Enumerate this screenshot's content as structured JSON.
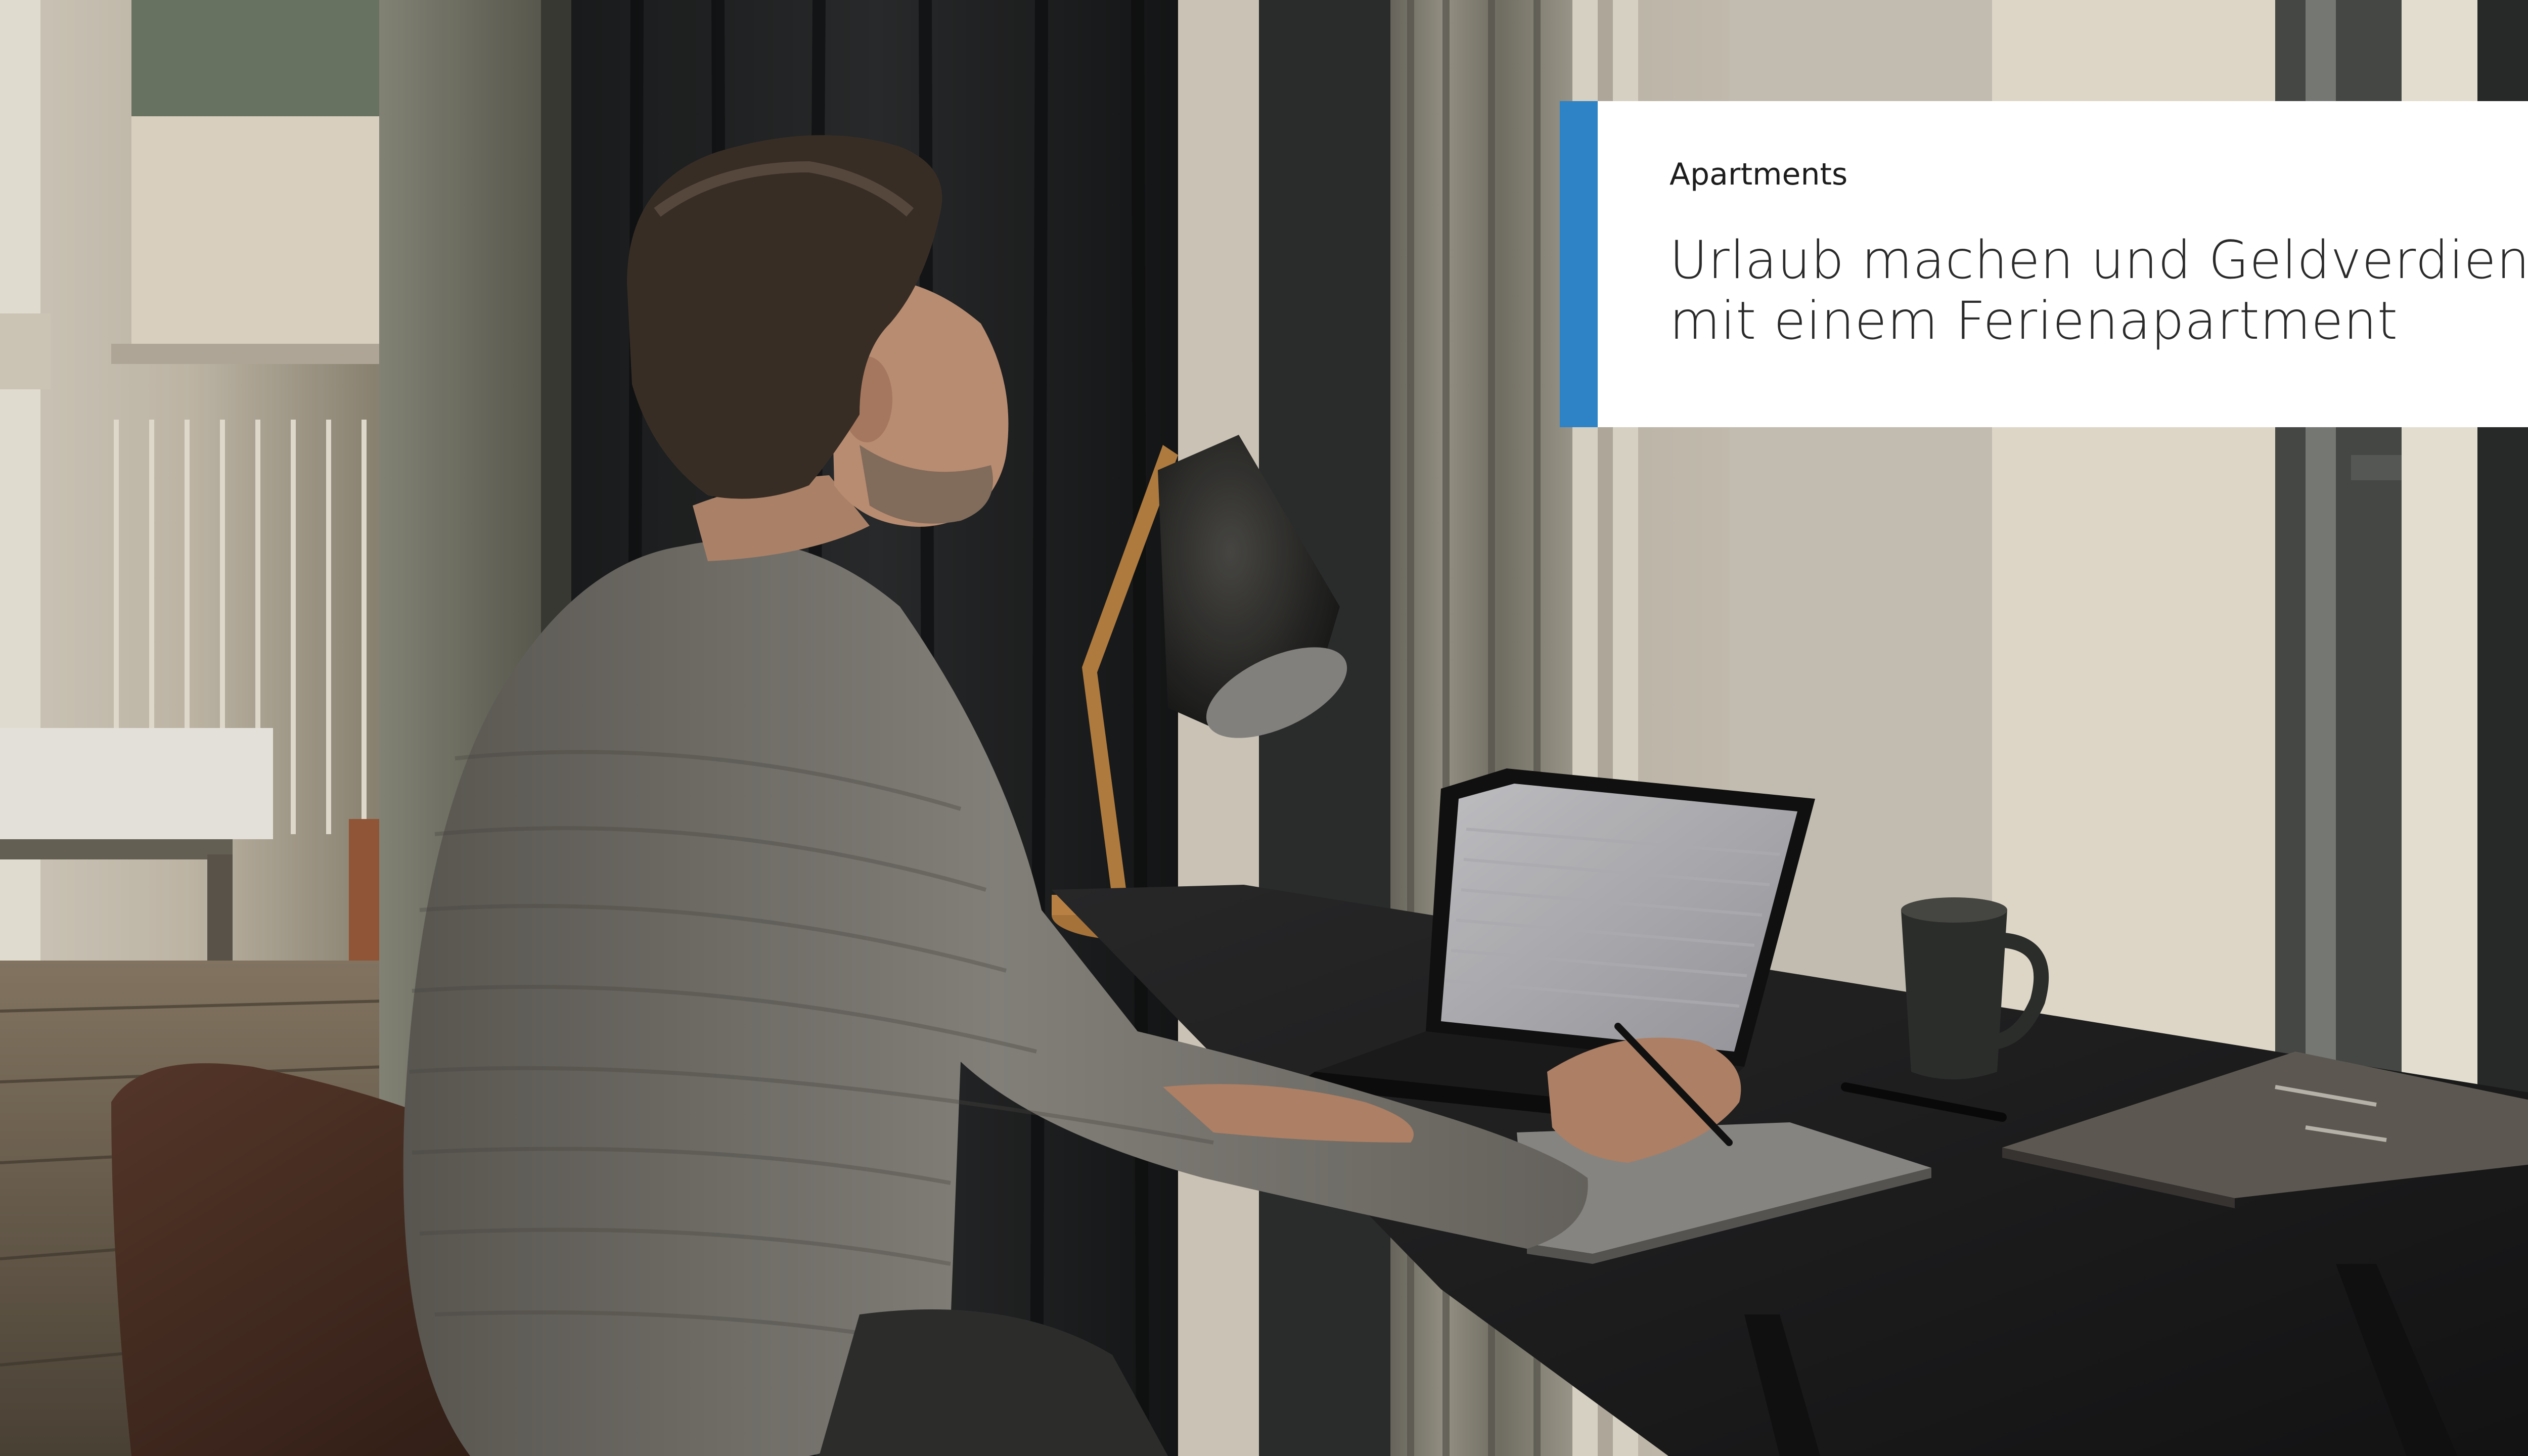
{
  "card": {
    "kicker": "Apartments",
    "title_line1": "Urlaub machen und Geldverdienen",
    "title_line2": "mit einem Ferienapartment"
  },
  "colors": {
    "accent": "#2e82c6",
    "card_background": "#ffffff",
    "text": "#2a2a2a"
  },
  "icons": {
    "hero_photo": "man-working-at-laptop-photo"
  }
}
